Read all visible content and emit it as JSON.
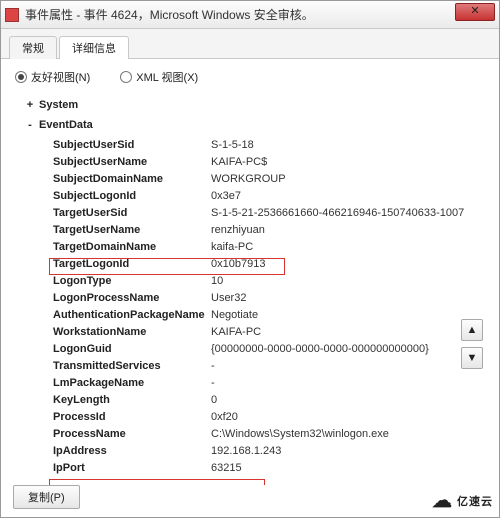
{
  "window": {
    "title": "事件属性 - 事件 4624，Microsoft Windows 安全审核。",
    "close_glyph": "✕"
  },
  "tabs": {
    "general": "常规",
    "details": "详细信息"
  },
  "view": {
    "friendly": "友好视图(N)",
    "xml": "XML 视图(X)"
  },
  "tree": {
    "system": "System",
    "eventdata": "EventData",
    "plus": "+",
    "minus": "-"
  },
  "fields": {
    "SubjectUserSid": "S-1-5-18",
    "SubjectUserName": "KAIFA-PC$",
    "SubjectDomainName": "WORKGROUP",
    "SubjectLogonId": "0x3e7",
    "TargetUserSid": "S-1-5-21-2536661660-466216946-150740633-1007",
    "TargetUserName": "renzhiyuan",
    "TargetDomainName": "kaifa-PC",
    "TargetLogonId": "0x10b7913",
    "LogonType": "10",
    "LogonProcessName": "User32",
    "AuthenticationPackageName": "Negotiate",
    "WorkstationName": "KAIFA-PC",
    "LogonGuid": "{00000000-0000-0000-0000-000000000000}",
    "TransmittedServices": "-",
    "LmPackageName": "-",
    "KeyLength": "0",
    "ProcessId": "0xf20",
    "ProcessName": "C:\\Windows\\System32\\winlogon.exe",
    "IpAddress": "192.168.1.243",
    "IpPort": "63215"
  },
  "labels": {
    "SubjectUserSid": "SubjectUserSid",
    "SubjectUserName": "SubjectUserName",
    "SubjectDomainName": "SubjectDomainName",
    "SubjectLogonId": "SubjectLogonId",
    "TargetUserSid": "TargetUserSid",
    "TargetUserName": "TargetUserName",
    "TargetDomainName": "TargetDomainName",
    "TargetLogonId": "TargetLogonId",
    "LogonType": "LogonType",
    "LogonProcessName": "LogonProcessName",
    "AuthenticationPackageName": "AuthenticationPackageName",
    "WorkstationName": "WorkstationName",
    "LogonGuid": "LogonGuid",
    "TransmittedServices": "TransmittedServices",
    "LmPackageName": "LmPackageName",
    "KeyLength": "KeyLength",
    "ProcessId": "ProcessId",
    "ProcessName": "ProcessName",
    "IpAddress": "IpAddress",
    "IpPort": "IpPort"
  },
  "nav": {
    "up": "▲",
    "down": "▼"
  },
  "footer": {
    "copy": "复制(P)"
  },
  "watermark": {
    "text": "亿速云",
    "cloud": "☁"
  }
}
